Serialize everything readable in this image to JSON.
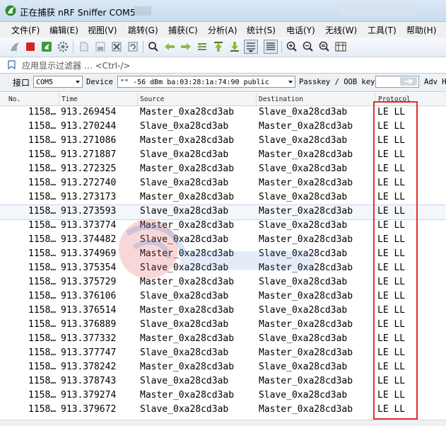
{
  "window": {
    "title": "正在捕获 nRF Sniffer COM5"
  },
  "menu": {
    "items": [
      "文件(F)",
      "编辑(E)",
      "视图(V)",
      "跳转(G)",
      "捕获(C)",
      "分析(A)",
      "统计(S)",
      "电话(Y)",
      "无线(W)",
      "工具(T)",
      "帮助(H)"
    ]
  },
  "toolbar": {
    "icons": [
      "shark-fin-start-icon",
      "stop-icon",
      "restart-icon",
      "options-gear-icon",
      "open-file-icon",
      "save-file-icon",
      "close-file-icon",
      "reload-icon",
      "find-icon",
      "back-arrow-icon",
      "forward-arrow-icon",
      "go-to-packet-icon",
      "first-packet-icon",
      "last-packet-icon",
      "autoscroll-icon",
      "colorize-icon",
      "zoom-in-icon",
      "zoom-out-icon",
      "zoom-normal-icon",
      "resize-columns-icon"
    ]
  },
  "filter": {
    "placeholder": "应用显示过滤器 … <Ctrl-/>"
  },
  "device_bar": {
    "interface_label": "接口",
    "interface_value": "COM5",
    "device_label": "Device",
    "device_value": "\"\"  -56 dBm  ba:03:28:1a:74:90  public",
    "passkey_label": "Passkey / OOB key",
    "adv_label": "Adv H"
  },
  "table": {
    "columns": [
      "No.",
      "Time",
      "Source",
      "Destination",
      "Protocol"
    ],
    "selected_index": 7,
    "rows": [
      {
        "no": "1158…",
        "time": "913.269454",
        "source": "Master_0xa28cd3ab",
        "destination": "Slave_0xa28cd3ab",
        "protocol": "LE LL"
      },
      {
        "no": "1158…",
        "time": "913.270244",
        "source": "Slave_0xa28cd3ab",
        "destination": "Master_0xa28cd3ab",
        "protocol": "LE LL"
      },
      {
        "no": "1158…",
        "time": "913.271086",
        "source": "Master_0xa28cd3ab",
        "destination": "Slave_0xa28cd3ab",
        "protocol": "LE LL"
      },
      {
        "no": "1158…",
        "time": "913.271887",
        "source": "Slave_0xa28cd3ab",
        "destination": "Master_0xa28cd3ab",
        "protocol": "LE LL"
      },
      {
        "no": "1158…",
        "time": "913.272325",
        "source": "Master_0xa28cd3ab",
        "destination": "Slave_0xa28cd3ab",
        "protocol": "LE LL"
      },
      {
        "no": "1158…",
        "time": "913.272740",
        "source": "Slave_0xa28cd3ab",
        "destination": "Master_0xa28cd3ab",
        "protocol": "LE LL"
      },
      {
        "no": "1158…",
        "time": "913.273173",
        "source": "Master_0xa28cd3ab",
        "destination": "Slave_0xa28cd3ab",
        "protocol": "LE LL"
      },
      {
        "no": "1158…",
        "time": "913.273593",
        "source": "Slave_0xa28cd3ab",
        "destination": "Master_0xa28cd3ab",
        "protocol": "LE LL"
      },
      {
        "no": "1158…",
        "time": "913.373774",
        "source": "Master_0xa28cd3ab",
        "destination": "Slave_0xa28cd3ab",
        "protocol": "LE LL"
      },
      {
        "no": "1158…",
        "time": "913.374482",
        "source": "Slave_0xa28cd3ab",
        "destination": "Master_0xa28cd3ab",
        "protocol": "LE LL"
      },
      {
        "no": "1158…",
        "time": "913.374969",
        "source": "Master_0xa28cd3ab",
        "destination": "Slave_0xa28cd3ab",
        "protocol": "LE LL"
      },
      {
        "no": "1158…",
        "time": "913.375354",
        "source": "Slave_0xa28cd3ab",
        "destination": "Master_0xa28cd3ab",
        "protocol": "LE LL"
      },
      {
        "no": "1158…",
        "time": "913.375729",
        "source": "Master_0xa28cd3ab",
        "destination": "Slave_0xa28cd3ab",
        "protocol": "LE LL"
      },
      {
        "no": "1158…",
        "time": "913.376106",
        "source": "Slave_0xa28cd3ab",
        "destination": "Master_0xa28cd3ab",
        "protocol": "LE LL"
      },
      {
        "no": "1158…",
        "time": "913.376514",
        "source": "Master_0xa28cd3ab",
        "destination": "Slave_0xa28cd3ab",
        "protocol": "LE LL"
      },
      {
        "no": "1158…",
        "time": "913.376889",
        "source": "Slave_0xa28cd3ab",
        "destination": "Master_0xa28cd3ab",
        "protocol": "LE LL"
      },
      {
        "no": "1158…",
        "time": "913.377332",
        "source": "Master_0xa28cd3ab",
        "destination": "Slave_0xa28cd3ab",
        "protocol": "LE LL"
      },
      {
        "no": "1158…",
        "time": "913.377747",
        "source": "Slave_0xa28cd3ab",
        "destination": "Master_0xa28cd3ab",
        "protocol": "LE LL"
      },
      {
        "no": "1158…",
        "time": "913.378242",
        "source": "Master_0xa28cd3ab",
        "destination": "Slave_0xa28cd3ab",
        "protocol": "LE LL"
      },
      {
        "no": "1158…",
        "time": "913.378743",
        "source": "Slave_0xa28cd3ab",
        "destination": "Master_0xa28cd3ab",
        "protocol": "LE LL"
      },
      {
        "no": "1158…",
        "time": "913.379274",
        "source": "Master_0xa28cd3ab",
        "destination": "Slave_0xa28cd3ab",
        "protocol": "LE LL"
      },
      {
        "no": "1158…",
        "time": "913.379672",
        "source": "Slave_0xa28cd3ab",
        "destination": "Master_0xa28cd3ab",
        "protocol": "LE LL"
      }
    ]
  },
  "colors": {
    "highlight_box": "#e03030",
    "watermark_red": "#d94a4a",
    "watermark_blue": "#4a7fd0"
  }
}
